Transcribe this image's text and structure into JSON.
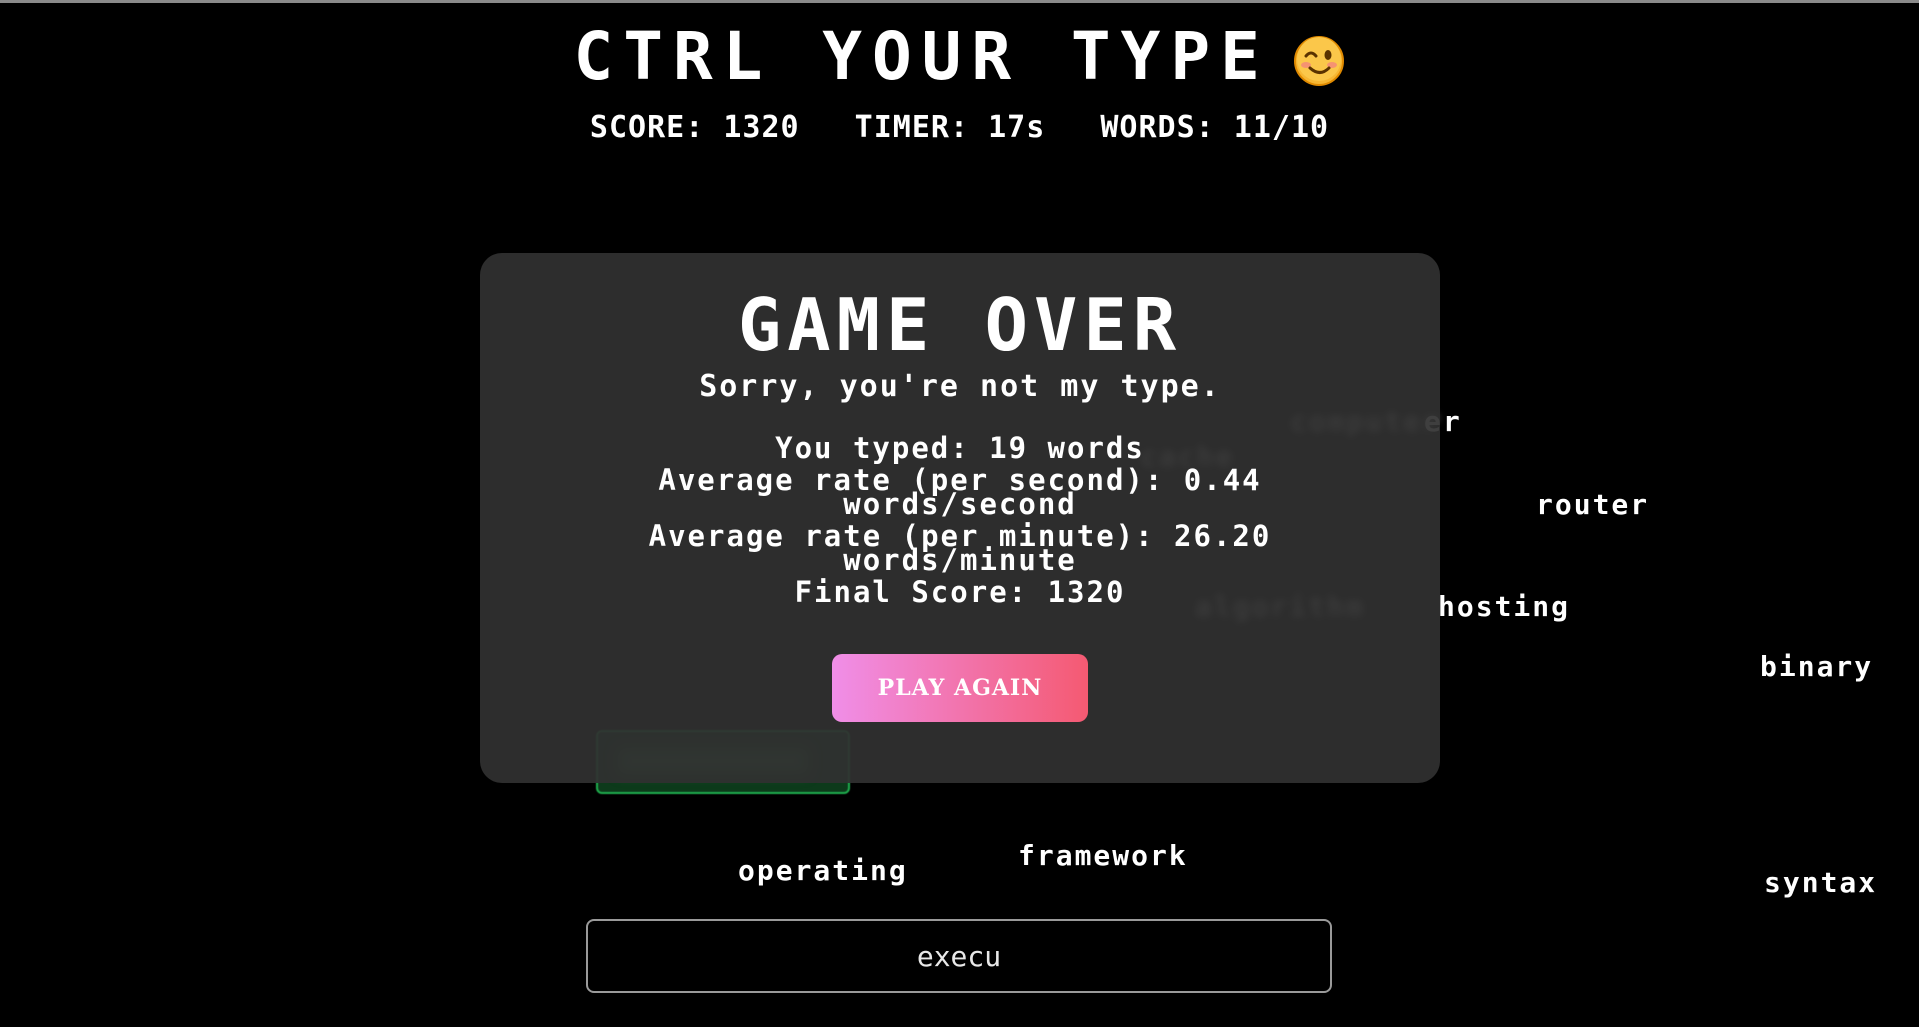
{
  "header": {
    "title": "CTRL YOUR TYPE",
    "emoji_icon": "winking-face-icon"
  },
  "stats": {
    "score": "SCORE: 1320",
    "timer": "TIMER: 17s",
    "words": "WORDS: 11/10"
  },
  "falling_words": {
    "computer_partial": "er",
    "router": "router",
    "hosting": "hosting",
    "binary": "binary",
    "operating": "operating",
    "framework": "framework",
    "syntax": "syntax"
  },
  "modal": {
    "title": "GAME OVER",
    "subtitle": "Sorry, you're not my type.",
    "typed": "You typed: 19 words",
    "rate_second_1": "Average rate (per second): 0.44",
    "rate_second_2": "words/second",
    "rate_minute_1": "Average rate (per minute): 26.20",
    "rate_minute_2": "words/minute",
    "final_score": "Final Score: 1320",
    "play_again": "PLAY AGAIN"
  },
  "input": {
    "value": "execu"
  },
  "colors": {
    "background": "#000000",
    "modal_bg": "#303030",
    "button_gradient_start": "#f08ee8",
    "button_gradient_end": "#f45a72",
    "input_border": "#9a9a9a",
    "green_accent": "#1fae4e"
  }
}
